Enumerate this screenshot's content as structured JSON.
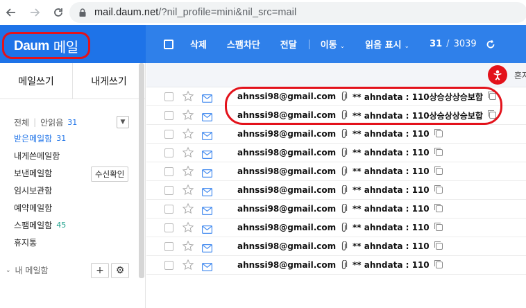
{
  "browser": {
    "url_host": "mail.daum.net",
    "url_path": "/?nil_profile=mini&nil_src=mail"
  },
  "header": {
    "logo_text": "Daum",
    "logo_mail": "메일",
    "toolbar": {
      "delete": "삭제",
      "block_spam": "스팸차단",
      "forward": "전달",
      "move": "이동",
      "mark_read": "읽음 표시",
      "count": "31",
      "slash": "/",
      "total": "3039"
    }
  },
  "sidebar": {
    "write_mail": "메일쓰기",
    "write_to_me": "내게쓰기",
    "all": "전체",
    "unread": "안읽음",
    "unread_count": "31",
    "folders": [
      {
        "label": "받은메일함",
        "count": "31"
      },
      {
        "label": "내게쓴메일함",
        "count": ""
      },
      {
        "label": "보낸메일함",
        "count": ""
      },
      {
        "label": "임시보관함",
        "count": ""
      },
      {
        "label": "예약메일함",
        "count": ""
      },
      {
        "label": "스팸메일함",
        "count": "45"
      },
      {
        "label": "휴지통",
        "count": ""
      }
    ],
    "read_receipt": "수신확인",
    "my_mailbox": "내 메일함",
    "add": "+",
    "settings": "⚙"
  },
  "main": {
    "promo_text": "혼자",
    "emails": [
      {
        "from": "ahnssi98@gmail.com",
        "subject": "** ahndata : 110상승상상승보합"
      },
      {
        "from": "ahnssi98@gmail.com",
        "subject": "** ahndata : 110상승상상승보합"
      },
      {
        "from": "ahnssi98@gmail.com",
        "subject": "** ahndata : 110"
      },
      {
        "from": "ahnssi98@gmail.com",
        "subject": "** ahndata : 110"
      },
      {
        "from": "ahnssi98@gmail.com",
        "subject": "** ahndata : 110"
      },
      {
        "from": "ahnssi98@gmail.com",
        "subject": "** ahndata : 110"
      },
      {
        "from": "ahnssi98@gmail.com",
        "subject": "** ahndata : 110"
      },
      {
        "from": "ahnssi98@gmail.com",
        "subject": "** ahndata : 110"
      },
      {
        "from": "ahnssi98@gmail.com",
        "subject": "** ahndata : 110"
      },
      {
        "from": "ahnssi98@gmail.com",
        "subject": "** ahndata : 110"
      }
    ]
  },
  "colors": {
    "header_blue": "#2f80ea",
    "annotation_red": "#e3121b",
    "link_blue": "#1e73e8",
    "spam_green": "#1fa28d"
  }
}
